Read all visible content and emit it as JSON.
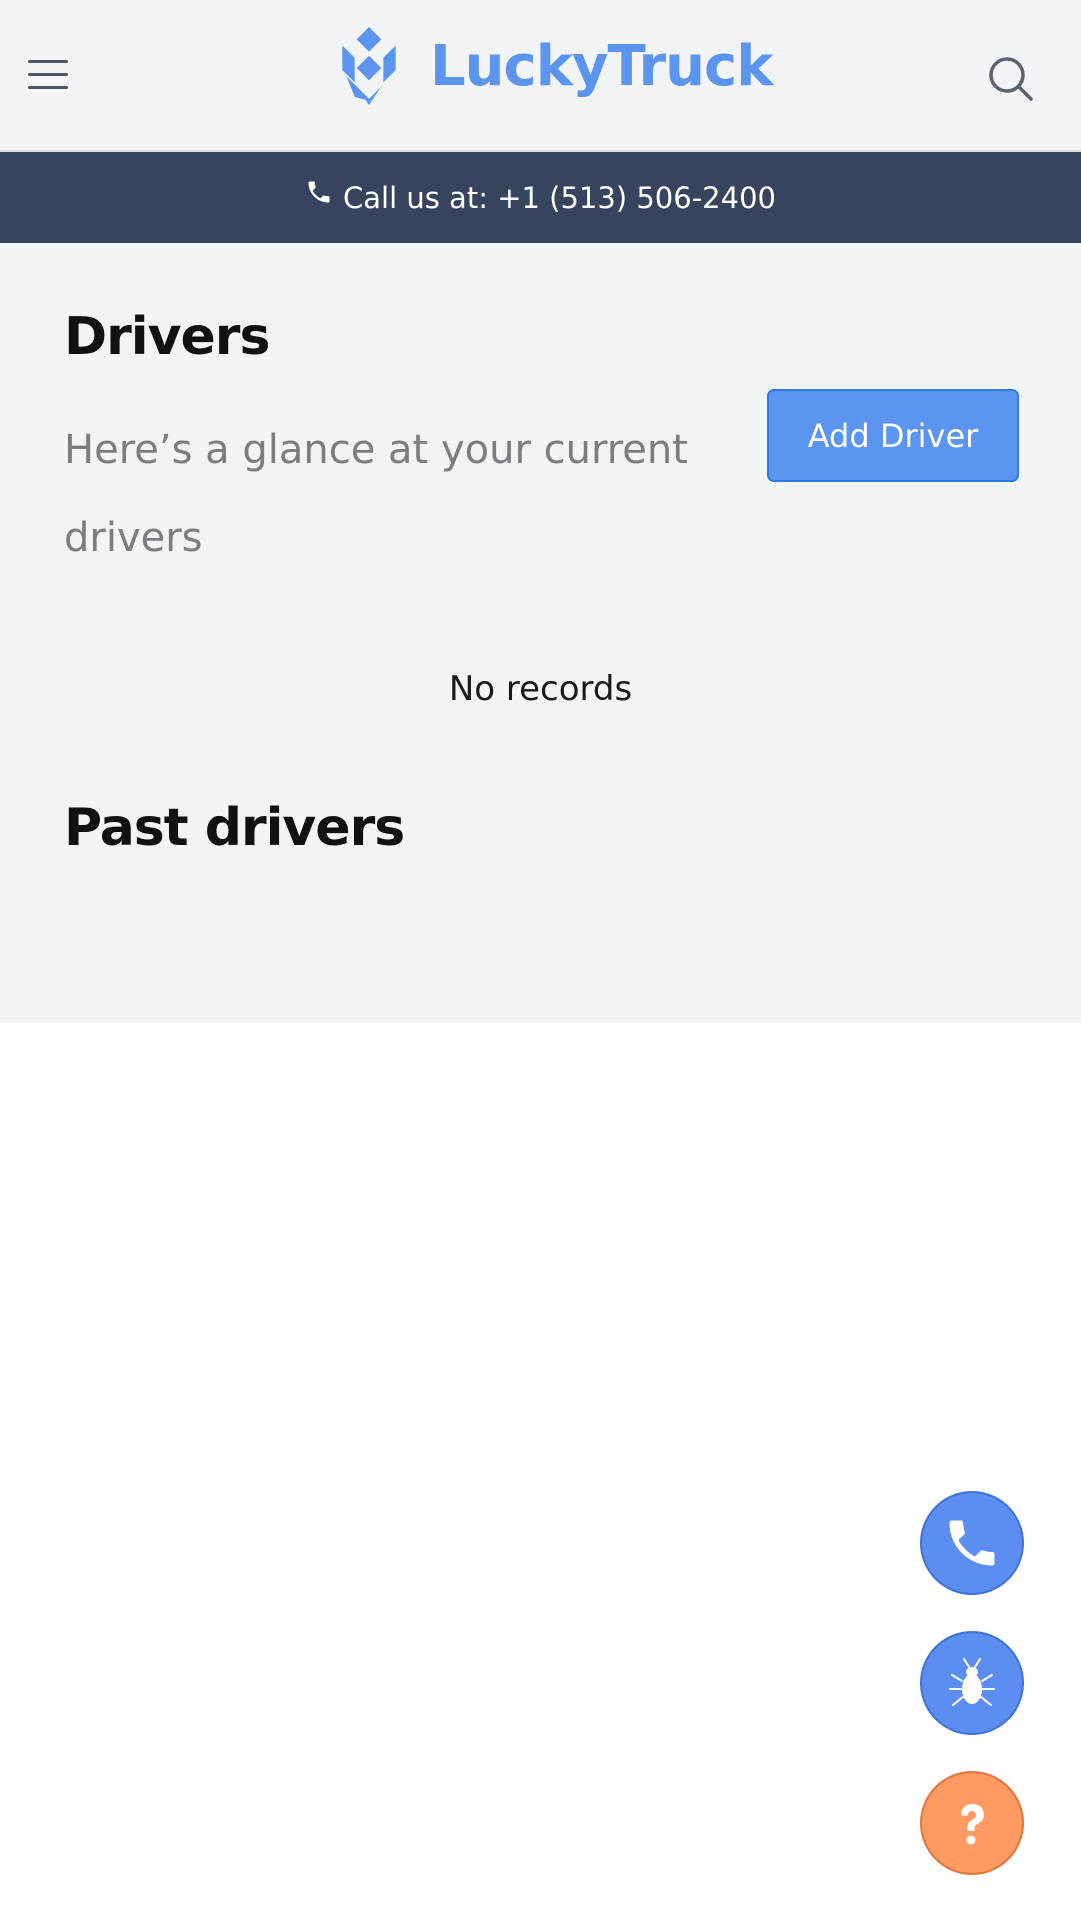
{
  "header": {
    "brand": "LuckyTruck",
    "menu_icon": "hamburger-menu-icon",
    "search_icon": "search-icon"
  },
  "callbar": {
    "text": "Call us at: +1 (513) 506-2400",
    "icon": "phone-icon"
  },
  "main": {
    "title": "Drivers",
    "subtitle": "Here’s a glance at your current drivers",
    "add_button": "Add Driver",
    "empty_message": "No records",
    "past_title": "Past drivers"
  },
  "fabs": [
    {
      "icon": "phone-icon",
      "color": "#5b8ef0"
    },
    {
      "icon": "bug-icon",
      "color": "#5b8ef0"
    },
    {
      "icon": "question-icon",
      "color": "#ff9a62"
    }
  ],
  "colors": {
    "brand": "#5b95f0",
    "callbar_bg": "#38445e",
    "page_bg": "#f3f4f6",
    "help_fab": "#ff9a62"
  }
}
